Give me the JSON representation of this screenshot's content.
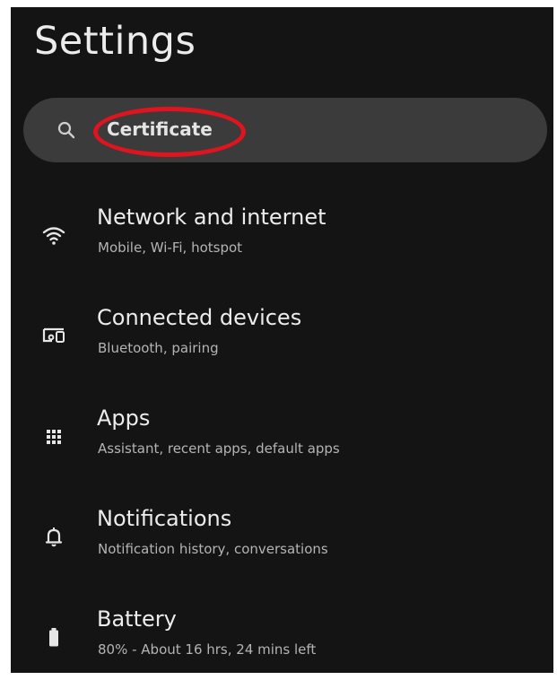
{
  "header": {
    "title": "Settings"
  },
  "search": {
    "icon": "search-icon",
    "value": "Certificate"
  },
  "colors": {
    "background": "#141414",
    "search_bar": "#3b3b3b",
    "highlight_ring": "#e0141e",
    "title_text": "#ececec",
    "subtitle_text": "#b4b4b4"
  },
  "items": [
    {
      "icon": "wifi-icon",
      "title": "Network and internet",
      "subtitle": "Mobile, Wi-Fi, hotspot"
    },
    {
      "icon": "connected-devices-icon",
      "title": "Connected devices",
      "subtitle": "Bluetooth, pairing"
    },
    {
      "icon": "apps-grid-icon",
      "title": "Apps",
      "subtitle": "Assistant, recent apps, default apps"
    },
    {
      "icon": "bell-icon",
      "title": "Notifications",
      "subtitle": "Notification history, conversations"
    },
    {
      "icon": "battery-icon",
      "title": "Battery",
      "subtitle": "80% - About 16 hrs, 24 mins left"
    }
  ]
}
